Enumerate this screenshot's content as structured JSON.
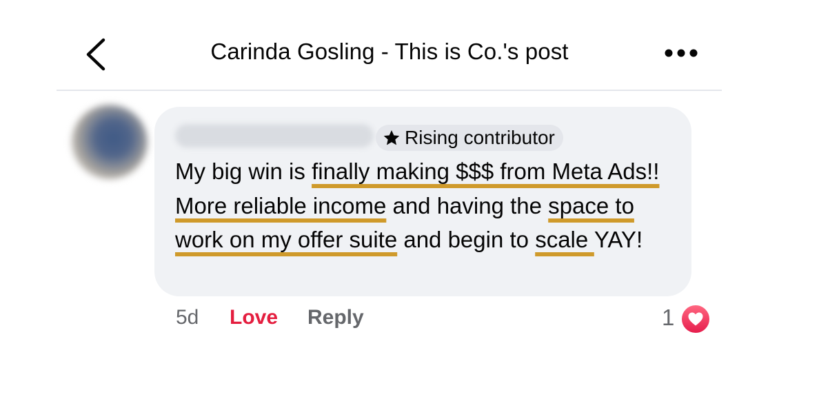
{
  "header": {
    "title": "Carinda Gosling - This is Co.'s post",
    "back_icon": "chevron-left-icon",
    "more_icon": "ellipsis-icon"
  },
  "comment": {
    "author_name": "",
    "badge": {
      "icon": "star-icon",
      "label": "Rising contributor"
    },
    "text_segments": [
      {
        "text": "My big win is ",
        "highlight": false
      },
      {
        "text": "finally making $$$ from Meta Ads!! More reliable income",
        "highlight": true
      },
      {
        "text": " and having the ",
        "highlight": false
      },
      {
        "text": "space to work on my offer suite",
        "highlight": true
      },
      {
        "text": " and begin to ",
        "highlight": false
      },
      {
        "text": "scale ",
        "highlight": true
      },
      {
        "text": "YAY!",
        "highlight": false
      }
    ],
    "highlight_color": "#cf9a2b",
    "timestamp": "5d",
    "love_label": "Love",
    "reply_label": "Reply",
    "reaction_count": "1",
    "reaction_icon": "heart-icon"
  },
  "colors": {
    "bubble": "#f0f2f5",
    "love_red": "#e41e3f",
    "secondary_text": "#65676b"
  }
}
